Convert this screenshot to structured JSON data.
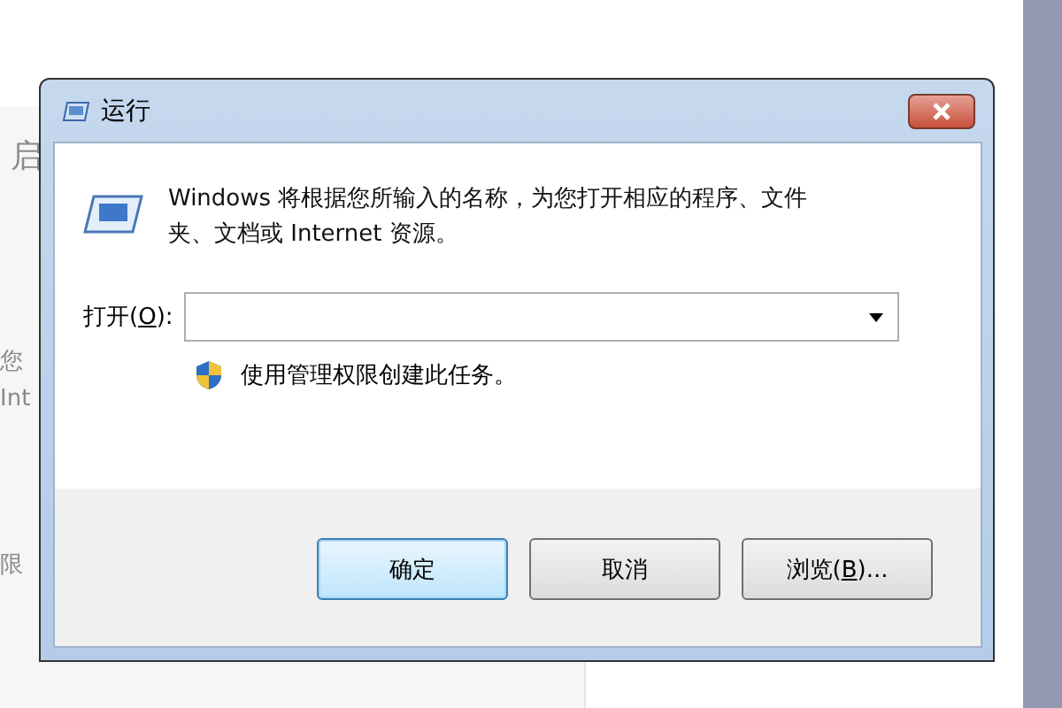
{
  "background": {
    "fragments": [
      "启",
      "您",
      "Int",
      "限"
    ]
  },
  "window": {
    "title": "运行"
  },
  "description": "Windows 将根据您所输入的名称，为您打开相应的程序、文件夹、文档或 Internet 资源。",
  "open_field": {
    "label": {
      "before": "打开(",
      "key": "O",
      "after": "):"
    }
  },
  "admin_note": "使用管理权限创建此任务。",
  "buttons": [
    {
      "label": {
        "before": "确定"
      },
      "default": true
    },
    {
      "label": {
        "before": "取消"
      },
      "default": false
    },
    {
      "label": {
        "before": "浏览(",
        "key": "B",
        "after": ")..."
      },
      "default": false
    }
  ]
}
